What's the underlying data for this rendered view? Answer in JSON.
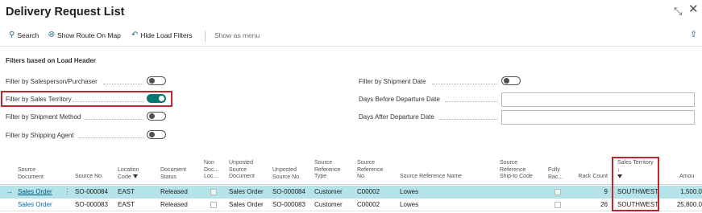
{
  "window": {
    "title": "Delivery Request List",
    "collapse_icon": "collapse-icon",
    "close_icon": "close-icon"
  },
  "toolbar": {
    "search_label": "Search",
    "show_route_label": "Show Route On Map",
    "hide_filters_label": "Hide Load Filters",
    "show_as_menu_label": "Show as menu",
    "share_icon": "share-icon"
  },
  "filters": {
    "section_title": "Filters based on Load Header",
    "salesperson_label": "Filter by Salesperson/Purchaser",
    "salesperson_on": false,
    "sales_territory_label": "Filter by Sales Territory",
    "sales_territory_on": true,
    "shipment_method_label": "Filter by Shipment Method",
    "shipment_method_on": false,
    "shipping_agent_label": "Filter by Shipping Agent",
    "shipping_agent_on": false,
    "shipment_date_label": "Filter by Shipment Date",
    "shipment_date_on": false,
    "days_before_label": "Days Before Departure Date",
    "days_before_value": "",
    "days_after_label": "Days After Departure Date",
    "days_after_value": ""
  },
  "grid": {
    "headers": {
      "source_document": "Source Document",
      "source_no": "Source No.",
      "location_code": "Location Code",
      "document_status": "Document Status",
      "non_doc_loc": "Non Doc... Loc...",
      "unposted_source_document": "Unposted Source Document",
      "unposted_source_no": "Unposted Source No.",
      "source_reference_type": "Source Reference Type",
      "source_reference_no": "Source Reference No.",
      "source_reference_name": "Source Reference Name",
      "source_reference_ship_to_code": "Source Reference Ship-to Code",
      "fully_rack": "Fully Rac...",
      "rack_count": "Rack Count",
      "sales_territory": "Sales Territory",
      "sales_territory_sort": "↓",
      "amount": "Amou"
    },
    "rows": [
      {
        "source_document": "Sales Order",
        "source_no": "SO-000084",
        "location_code": "EAST",
        "document_status": "Released",
        "unposted_source_document": "Sales Order",
        "unposted_source_no": "SO-000084",
        "source_reference_type": "Customer",
        "source_reference_no": "C00002",
        "source_reference_name": "Lowes",
        "rack_count": "9",
        "sales_territory": "SOUTHWEST",
        "amount": "1,500.0"
      },
      {
        "source_document": "Sales Order",
        "source_no": "SO-000083",
        "location_code": "EAST",
        "document_status": "Released",
        "unposted_source_document": "Sales Order",
        "unposted_source_no": "SO-000083",
        "source_reference_type": "Customer",
        "source_reference_no": "C00002",
        "source_reference_name": "Lowes",
        "rack_count": "26",
        "sales_territory": "SOUTHWEST",
        "amount": "25,800.0"
      }
    ]
  },
  "colors": {
    "accent": "#00786f",
    "highlight_border": "#c0272d",
    "selected_row": "#b4e4ea",
    "link": "#006cab"
  }
}
